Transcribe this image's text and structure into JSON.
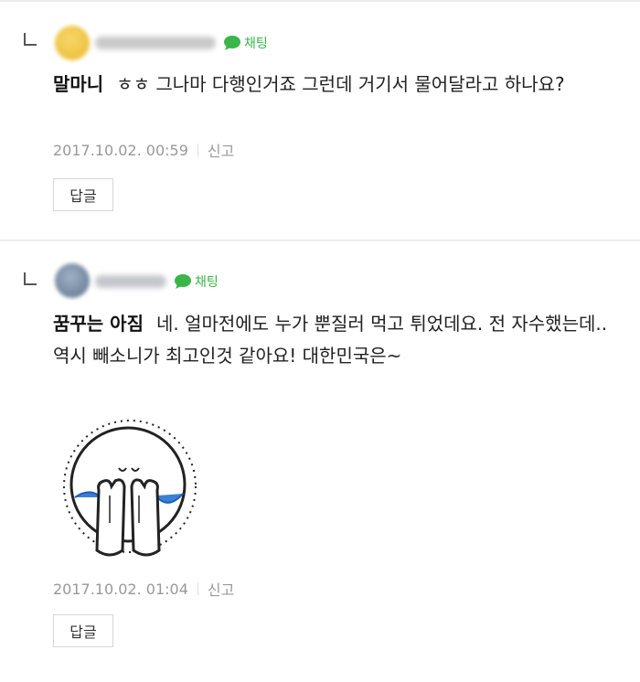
{
  "comments": [
    {
      "chat_label": "채팅",
      "author": "말마니",
      "text": "ㅎㅎ 그나마 다행인거죠 그런데 거기서 물어달라고 하나요?",
      "timestamp": "2017.10.02. 00:59",
      "report_label": "신고",
      "reply_label": "답글",
      "avatar_color": "#f2c94c"
    },
    {
      "chat_label": "채팅",
      "author": "꿈꾸는 아짐",
      "text": "네. 얼마전에도 누가 뿐질러 먹고 튀었데요. 전 자수했는데.. 역시 빼소니가 최고인것 같아요! 대한민국은~",
      "timestamp": "2017.10.02. 01:04",
      "report_label": "신고",
      "reply_label": "답글",
      "avatar_color": "#7a8fa6",
      "sticker": "crying-face-sticker"
    }
  ],
  "colors": {
    "chat_green": "#39b54a",
    "meta_gray": "#999999",
    "divider": "#ececec"
  }
}
